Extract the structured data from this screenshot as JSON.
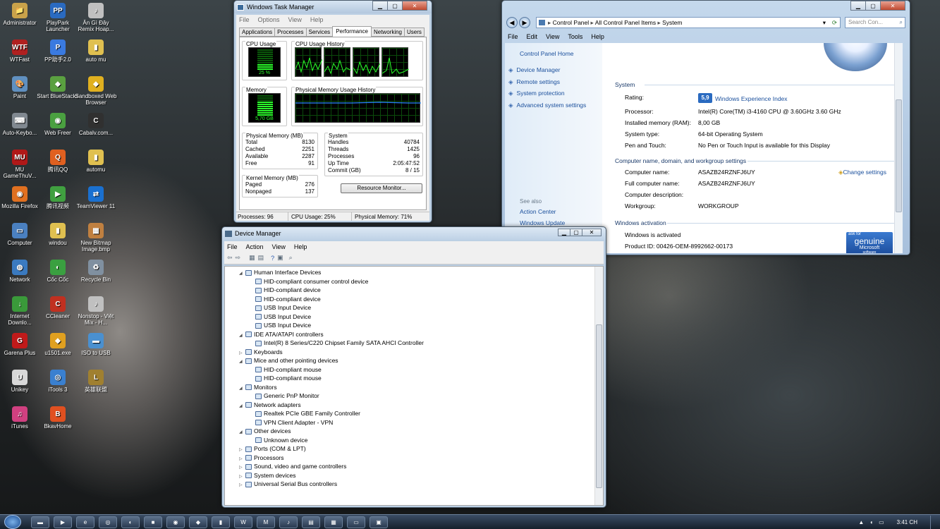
{
  "desktop": {
    "icons": [
      {
        "label": "Administrator",
        "glyph": "📁",
        "color": "#c9a24a"
      },
      {
        "label": "PlayPark Launcher",
        "glyph": "PP",
        "color": "#2a6ac0"
      },
      {
        "label": "Ăn Gì Đây Remix Hoap...",
        "glyph": "♪",
        "color": "#c0c0c0"
      },
      {
        "label": "WTFast",
        "glyph": "WTF",
        "color": "#b02020"
      },
      {
        "label": "PP助手2.0",
        "glyph": "P",
        "color": "#3a7ae0"
      },
      {
        "label": "auto mu",
        "glyph": "▮",
        "color": "#e0c050"
      },
      {
        "label": "Paint",
        "glyph": "🎨",
        "color": "#6090c0"
      },
      {
        "label": "Start BlueStacks",
        "glyph": "◆",
        "color": "#5aa040"
      },
      {
        "label": "Sandboxed Web Browser",
        "glyph": "◆",
        "color": "#e0b020"
      },
      {
        "label": "Auto-Keybo...",
        "glyph": "⌨",
        "color": "#808890"
      },
      {
        "label": "Web Freer",
        "glyph": "◉",
        "color": "#4aa040"
      },
      {
        "label": "Cabalv.com...",
        "glyph": "C",
        "color": "#303030"
      },
      {
        "label": "MU GameThuV...",
        "glyph": "MU",
        "color": "#b01818"
      },
      {
        "label": "腾讯QQ",
        "glyph": "Q",
        "color": "#e06020"
      },
      {
        "label": "automu",
        "glyph": "▮",
        "color": "#e0c050"
      },
      {
        "label": "Mozilla Firefox",
        "glyph": "◉",
        "color": "#e07020"
      },
      {
        "label": "腾讯视频",
        "glyph": "▶",
        "color": "#40a040"
      },
      {
        "label": "TeamViewer 11",
        "glyph": "⇄",
        "color": "#1a70d0"
      },
      {
        "label": "Computer",
        "glyph": "▭",
        "color": "#4a80c0"
      },
      {
        "label": "windou",
        "glyph": "▮",
        "color": "#e0c050"
      },
      {
        "label": "New Bitmap Image.bmp",
        "glyph": "▦",
        "color": "#c08040"
      },
      {
        "label": "Network",
        "glyph": "◍",
        "color": "#3a7ac0"
      },
      {
        "label": "Cốc Cốc",
        "glyph": "◐",
        "color": "#3aa040"
      },
      {
        "label": "Recycle Bin",
        "glyph": "♻",
        "color": "#8090a0"
      },
      {
        "label": "Internet Downlo...",
        "glyph": "↓",
        "color": "#3a9a3a"
      },
      {
        "label": "CCleaner",
        "glyph": "C",
        "color": "#c03020"
      },
      {
        "label": "Nonstop - Việt Mix - H...",
        "glyph": "♪",
        "color": "#c0c0c0"
      },
      {
        "label": "Garena Plus",
        "glyph": "G",
        "color": "#c01a1a"
      },
      {
        "label": "u1501.exe",
        "glyph": "◆",
        "color": "#e0a020"
      },
      {
        "label": "ISO to USB",
        "glyph": "▬",
        "color": "#4a90d0"
      },
      {
        "label": "Unikey",
        "glyph": "U",
        "color": "#d8d8d8"
      },
      {
        "label": "iTools 3",
        "glyph": "◎",
        "color": "#3a80d0"
      },
      {
        "label": "英雄联盟",
        "glyph": "L",
        "color": "#a08030"
      },
      {
        "label": "iTunes",
        "glyph": "♫",
        "color": "#d04080"
      },
      {
        "label": "BkavHome",
        "glyph": "B",
        "color": "#e05020"
      }
    ]
  },
  "taskmgr": {
    "title": "Windows Task Manager",
    "menu": [
      "File",
      "Options",
      "View",
      "Help"
    ],
    "tabs": [
      "Applications",
      "Processes",
      "Services",
      "Performance",
      "Networking",
      "Users"
    ],
    "active_tab": "Performance",
    "cpu_usage_label": "CPU Usage",
    "cpu_usage_value": "25 %",
    "cpu_usage_fraction": 0.25,
    "cpu_history_label": "CPU Usage History",
    "memory_label": "Memory",
    "memory_value": "5,70 GB",
    "memory_fraction": 0.71,
    "mem_history_label": "Physical Memory Usage History",
    "physical_memory": {
      "title": "Physical Memory (MB)",
      "rows": [
        [
          "Total",
          "8130"
        ],
        [
          "Cached",
          "2251"
        ],
        [
          "Available",
          "2287"
        ],
        [
          "Free",
          "91"
        ]
      ]
    },
    "kernel_memory": {
      "title": "Kernel Memory (MB)",
      "rows": [
        [
          "Paged",
          "276"
        ],
        [
          "Nonpaged",
          "137"
        ]
      ]
    },
    "system": {
      "title": "System",
      "rows": [
        [
          "Handles",
          "40784"
        ],
        [
          "Threads",
          "1425"
        ],
        [
          "Processes",
          "96"
        ],
        [
          "Up Time",
          "2:05:47:52"
        ],
        [
          "Commit (GB)",
          "8 / 15"
        ]
      ]
    },
    "resource_monitor_button": "Resource Monitor...",
    "status": {
      "processes": "Processes: 96",
      "cpu": "CPU Usage: 25%",
      "memory": "Physical Memory: 71%"
    }
  },
  "control_panel": {
    "breadcrumb": [
      "Control Panel",
      "All Control Panel Items",
      "System"
    ],
    "search_placeholder": "Search Con...",
    "menu": [
      "File",
      "Edit",
      "View",
      "Tools",
      "Help"
    ],
    "home_link": "Control Panel Home",
    "side_links": [
      "Device Manager",
      "Remote settings",
      "System protection",
      "Advanced system settings"
    ],
    "see_also_label": "See also",
    "see_also_links": [
      "Action Center",
      "Windows Update"
    ],
    "system_section": "System",
    "rating_label": "Rating:",
    "rating_score": "5,9",
    "rating_link": "Windows Experience Index",
    "system_rows": [
      [
        "Processor:",
        "Intel(R) Core(TM) i3-4160 CPU @ 3.60GHz   3.60 GHz"
      ],
      [
        "Installed memory (RAM):",
        "8,00 GB"
      ],
      [
        "System type:",
        "64-bit Operating System"
      ],
      [
        "Pen and Touch:",
        "No Pen or Touch Input is available for this Display"
      ]
    ],
    "computer_section": "Computer name, domain, and workgroup settings",
    "change_settings": "Change settings",
    "computer_rows": [
      [
        "Computer name:",
        "ASAZB24RZNFJ6UY"
      ],
      [
        "Full computer name:",
        "ASAZB24RZNFJ6UY"
      ],
      [
        "Computer description:",
        ""
      ],
      [
        "Workgroup:",
        "WORKGROUP"
      ]
    ],
    "activation_section": "Windows activation",
    "activation_status": "Windows is activated",
    "product_id": "Product ID: 00426-OEM-8992662-00173",
    "genuine_small": "ask for",
    "genuine_big": "genuine",
    "genuine_ms": "Microsoft",
    "genuine_sw": "software"
  },
  "device_manager": {
    "title": "Device Manager",
    "menu": [
      "File",
      "Action",
      "View",
      "Help"
    ],
    "tree": [
      {
        "level": 0,
        "text": "Human Interface Devices",
        "expanded": true
      },
      {
        "level": 1,
        "text": "HID-compliant consumer control device"
      },
      {
        "level": 1,
        "text": "HID-compliant device"
      },
      {
        "level": 1,
        "text": "HID-compliant device"
      },
      {
        "level": 1,
        "text": "USB Input Device"
      },
      {
        "level": 1,
        "text": "USB Input Device"
      },
      {
        "level": 1,
        "text": "USB Input Device"
      },
      {
        "level": 0,
        "text": "IDE ATA/ATAPI controllers",
        "expanded": true
      },
      {
        "level": 1,
        "text": "Intel(R) 8 Series/C220 Chipset Family SATA AHCI Controller"
      },
      {
        "level": 0,
        "text": "Keyboards",
        "expanded": false
      },
      {
        "level": 0,
        "text": "Mice and other pointing devices",
        "expanded": true
      },
      {
        "level": 1,
        "text": "HID-compliant mouse"
      },
      {
        "level": 1,
        "text": "HID-compliant mouse"
      },
      {
        "level": 0,
        "text": "Monitors",
        "expanded": true
      },
      {
        "level": 1,
        "text": "Generic PnP Monitor"
      },
      {
        "level": 0,
        "text": "Network adapters",
        "expanded": true
      },
      {
        "level": 1,
        "text": "Realtek PCIe GBE Family Controller"
      },
      {
        "level": 1,
        "text": "VPN Client Adapter - VPN"
      },
      {
        "level": 0,
        "text": "Other devices",
        "expanded": true
      },
      {
        "level": 1,
        "text": "Unknown device"
      },
      {
        "level": 0,
        "text": "Ports (COM & LPT)",
        "expanded": false
      },
      {
        "level": 0,
        "text": "Processors",
        "expanded": false
      },
      {
        "level": 0,
        "text": "Sound, video and game controllers",
        "expanded": false
      },
      {
        "level": 0,
        "text": "System devices",
        "expanded": false
      },
      {
        "level": 0,
        "text": "Universal Serial Bus controllers",
        "expanded": false
      }
    ]
  },
  "taskbar": {
    "clock": "3:41 CH"
  }
}
